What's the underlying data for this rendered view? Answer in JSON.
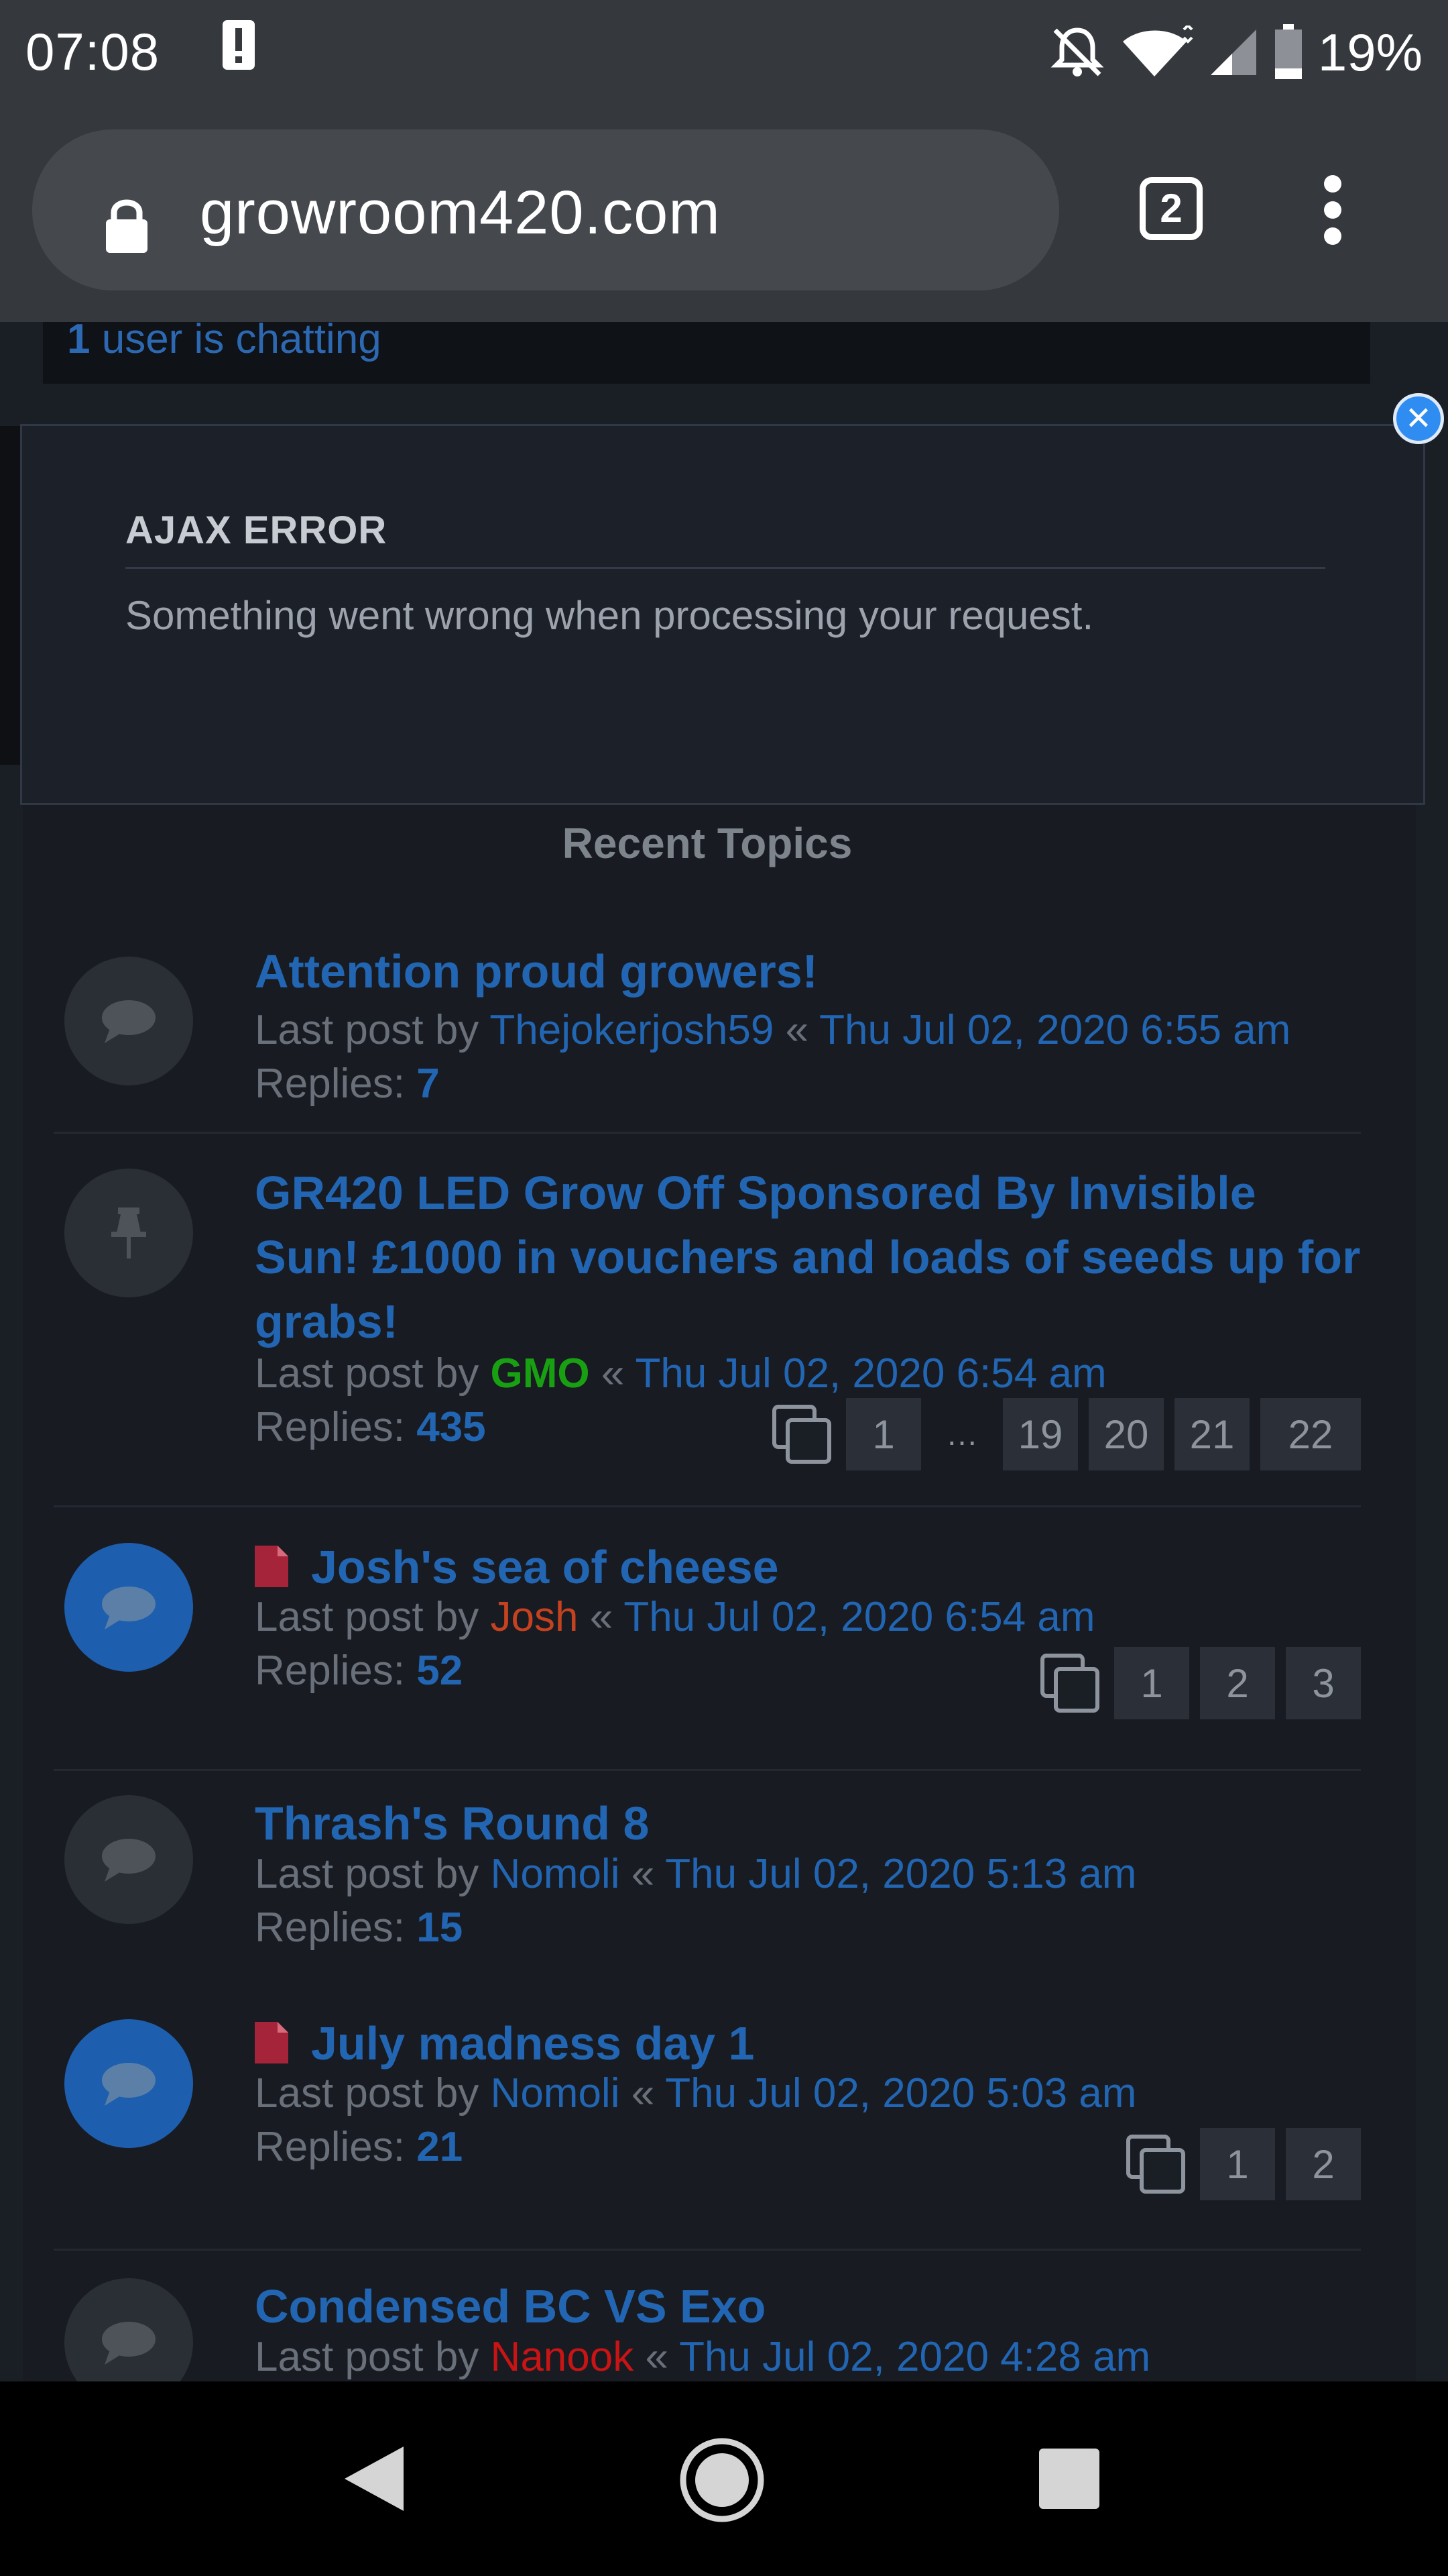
{
  "status_bar": {
    "time": "07:08",
    "battery": "19%"
  },
  "browser": {
    "url": "growroom420.com",
    "tab_count": "2"
  },
  "chat": {
    "count": "1",
    "text": " user is chatting"
  },
  "ajax_error": {
    "title": "AJAX ERROR",
    "message": "Something went wrong when processing your request."
  },
  "recent": {
    "header": "Recent Topics"
  },
  "labels": {
    "last_post_by": "Last post by ",
    "separator": " « ",
    "replies": "Replies: "
  },
  "topics": [
    {
      "title": "Attention proud growers!",
      "user": "Thejokerjosh59",
      "date": "Thu Jul 02, 2020 6:55 am",
      "replies": "7"
    },
    {
      "title": "GR420 LED Grow Off Sponsored By Invisible Sun! £1000 in vouchers and loads of seeds up for grabs!",
      "user": "GMO",
      "date": "Thu Jul 02, 2020 6:54 am",
      "replies": "435",
      "pages": [
        "1",
        "…",
        "19",
        "20",
        "21",
        "22"
      ]
    },
    {
      "title": "Josh's sea of cheese",
      "user": "Josh",
      "date": "Thu Jul 02, 2020 6:54 am",
      "replies": "52",
      "pages": [
        "1",
        "2",
        "3"
      ]
    },
    {
      "title": "Thrash's Round 8",
      "user": "Nomoli",
      "date": "Thu Jul 02, 2020 5:13 am",
      "replies": "15"
    },
    {
      "title": "July madness day 1",
      "user": "Nomoli",
      "date": "Thu Jul 02, 2020 5:03 am",
      "replies": "21",
      "pages": [
        "1",
        "2"
      ]
    },
    {
      "title": "Condensed BC VS Exo",
      "user": "Nanook",
      "date": "Thu Jul 02, 2020 4:28 am"
    }
  ],
  "icons": [
    "alert-icon",
    "bell-off-icon",
    "wifi-icon",
    "signal-icon",
    "battery-icon",
    "lock-icon",
    "menu-icon",
    "close-icon",
    "chat-bubble-icon",
    "pin-icon",
    "document-icon",
    "pages-icon",
    "back-icon",
    "home-icon",
    "recents-icon"
  ],
  "colors": {
    "link": "#2266b3",
    "unread": "#1d5fae",
    "close_button": "#2f8cf0",
    "user_green": "#18a012",
    "user_orange": "#c4421f",
    "user_red": "#c81414"
  }
}
